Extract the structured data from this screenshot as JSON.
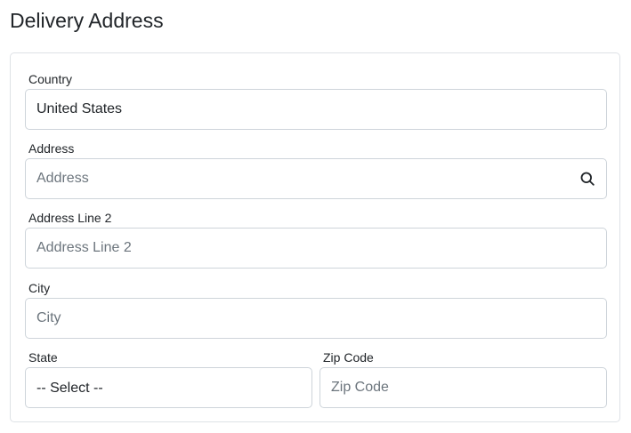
{
  "page": {
    "title": "Delivery Address"
  },
  "form": {
    "country": {
      "label": "Country",
      "value": "United States",
      "placeholder": "Country"
    },
    "address": {
      "label": "Address",
      "placeholder": "Address",
      "icon": "search-icon"
    },
    "address_line_2": {
      "label": "Address Line 2",
      "placeholder": "Address Line 2"
    },
    "city": {
      "label": "City",
      "placeholder": "City"
    },
    "state": {
      "label": "State",
      "selected": "-- Select --"
    },
    "zip": {
      "label": "Zip Code",
      "placeholder": "Zip Code"
    }
  },
  "colors": {
    "border": "#ced4da",
    "card_border": "#dee2e6",
    "text": "#212529",
    "placeholder": "#6c757d"
  }
}
